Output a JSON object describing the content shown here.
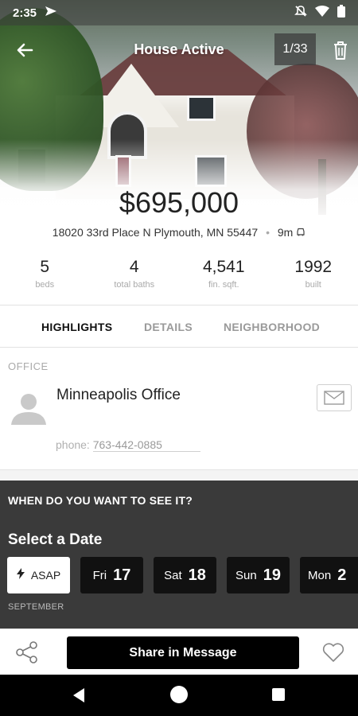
{
  "status_bar": {
    "time": "2:35"
  },
  "header": {
    "title": "House Active",
    "counter": "1/33"
  },
  "listing": {
    "price": "$695,000",
    "address": "18020 33rd Place N Plymouth, MN 55447",
    "drive_time": "9m"
  },
  "stats": [
    {
      "value": "5",
      "label": "beds"
    },
    {
      "value": "4",
      "label": "total baths"
    },
    {
      "value": "4,541",
      "label": "fin. sqft."
    },
    {
      "value": "1992",
      "label": "built"
    }
  ],
  "tabs": [
    {
      "label": "HIGHLIGHTS",
      "active": true
    },
    {
      "label": "DETAILS",
      "active": false
    },
    {
      "label": "NEIGHBORHOOD",
      "active": false
    }
  ],
  "office": {
    "heading": "OFFICE",
    "name": "Minneapolis Office",
    "phone_label": "phone:",
    "phone": "763-442-0885"
  },
  "schedule": {
    "question": "WHEN DO YOU WANT TO SEE IT?",
    "select_label": "Select a Date",
    "asap_label": "ASAP",
    "dates": [
      {
        "day": "Fri",
        "num": "17"
      },
      {
        "day": "Sat",
        "num": "18"
      },
      {
        "day": "Sun",
        "num": "19"
      },
      {
        "day": "Mon",
        "num": "2"
      }
    ],
    "month": "SEPTEMBER"
  },
  "actions": {
    "share_message": "Share in Message"
  },
  "icons": {
    "back": "arrow-left-icon",
    "trash": "trash-icon",
    "car": "car-icon",
    "mail": "mail-icon",
    "avatar": "person-icon",
    "bolt": "lightning-icon",
    "share": "share-icon",
    "heart": "heart-icon"
  }
}
